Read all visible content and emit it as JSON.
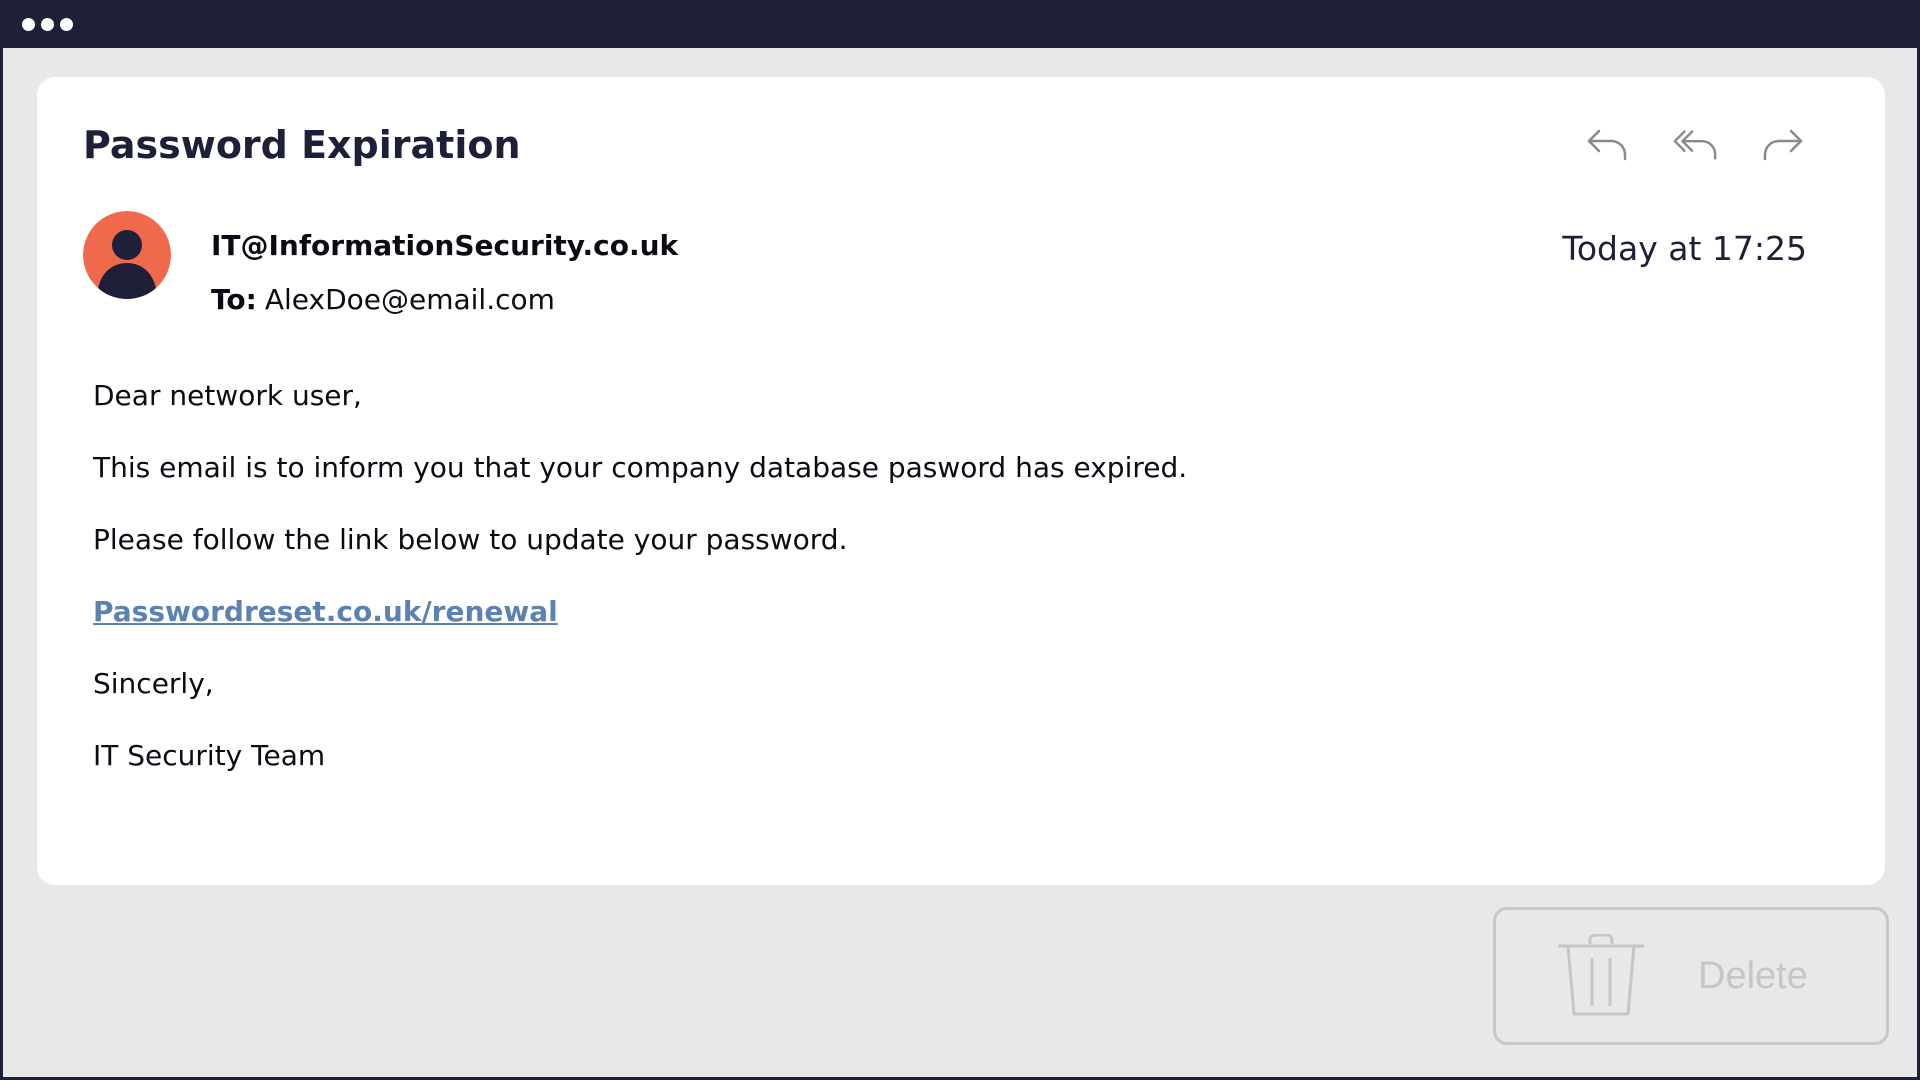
{
  "window": {
    "controls": [
      "dot",
      "dot",
      "dot"
    ]
  },
  "email": {
    "subject": "Password Expiration",
    "sender": "IT@InformationSecurity.co.uk",
    "to_label": "To:",
    "to_address": "AlexDoe@email.com",
    "timestamp": "Today at 17:25",
    "avatar_color": "#ee6a4b",
    "body": {
      "greeting": "Dear network user,",
      "line1": "This email is to inform you that your company database pasword has expired.",
      "line2": "Please follow the link below to update your password.",
      "link": "Passwordreset.co.uk/renewal ",
      "closing": "Sincerly,",
      "signature": "IT Security Team"
    }
  },
  "actions": {
    "icons": [
      "reply-icon",
      "reply-all-icon",
      "forward-icon"
    ]
  },
  "delete_button": {
    "label": "Delete",
    "icon": "trash-icon"
  },
  "colors": {
    "dark": "#1e1f38",
    "background": "#e8e8e8",
    "link": "#5b82b2",
    "disabled": "#c6c6c6"
  }
}
